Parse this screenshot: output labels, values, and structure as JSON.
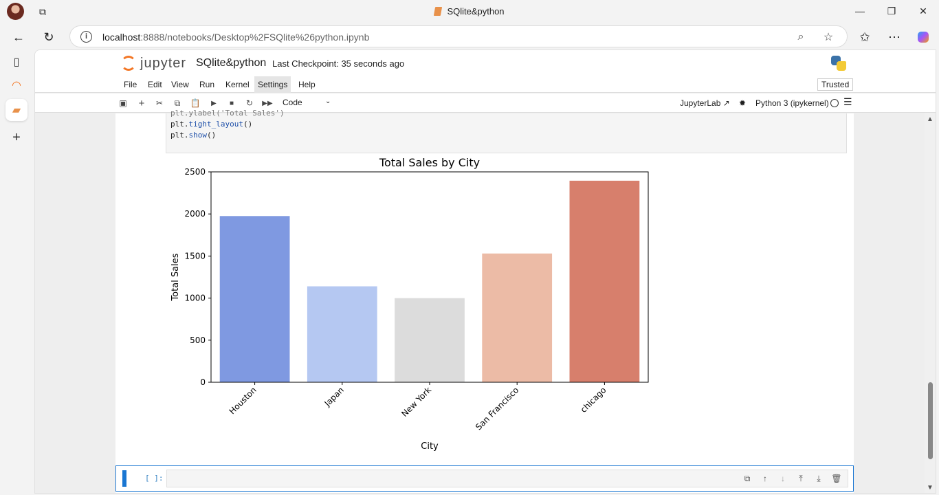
{
  "browser": {
    "tab_title": "SQlite&python",
    "url_host": "localhost",
    "url_rest": ":8888/notebooks/Desktop%2FSQlite%26python.ipynb"
  },
  "jupyter": {
    "logo_text": "jupyter",
    "notebook_title": "SQlite&python",
    "checkpoint": "Last Checkpoint: 35 seconds ago",
    "menu": [
      "File",
      "Edit",
      "View",
      "Run",
      "Kernel",
      "Settings",
      "Help"
    ],
    "trusted": "Trusted",
    "cell_type": "Code",
    "jupyterlab_link": "JupyterLab",
    "kernel": "Python 3 (ipykernel)"
  },
  "code_lines": {
    "cut": "plt.ylabel('Total Sales')",
    "line1_pre": "plt.",
    "line1_fn": "tight_layout",
    "line1_post": "()",
    "line2_pre": "plt.",
    "line2_fn": "show",
    "line2_post": "()"
  },
  "empty_cell_prompt": "[ ]:",
  "chart_data": {
    "type": "bar",
    "title": "Total Sales by City",
    "xlabel": "City",
    "ylabel": "Total Sales",
    "categories": [
      "Houston",
      "Japan",
      "New York",
      "San Francisco",
      "chicago"
    ],
    "values": [
      1975,
      1140,
      1000,
      1530,
      2395
    ],
    "colors": [
      "#7f99e1",
      "#b5c8f2",
      "#dcdcdc",
      "#ecbba6",
      "#d77f6c"
    ],
    "ylim": [
      0,
      2500
    ],
    "yticks": [
      0,
      500,
      1000,
      1500,
      2000,
      2500
    ],
    "grid": false
  }
}
